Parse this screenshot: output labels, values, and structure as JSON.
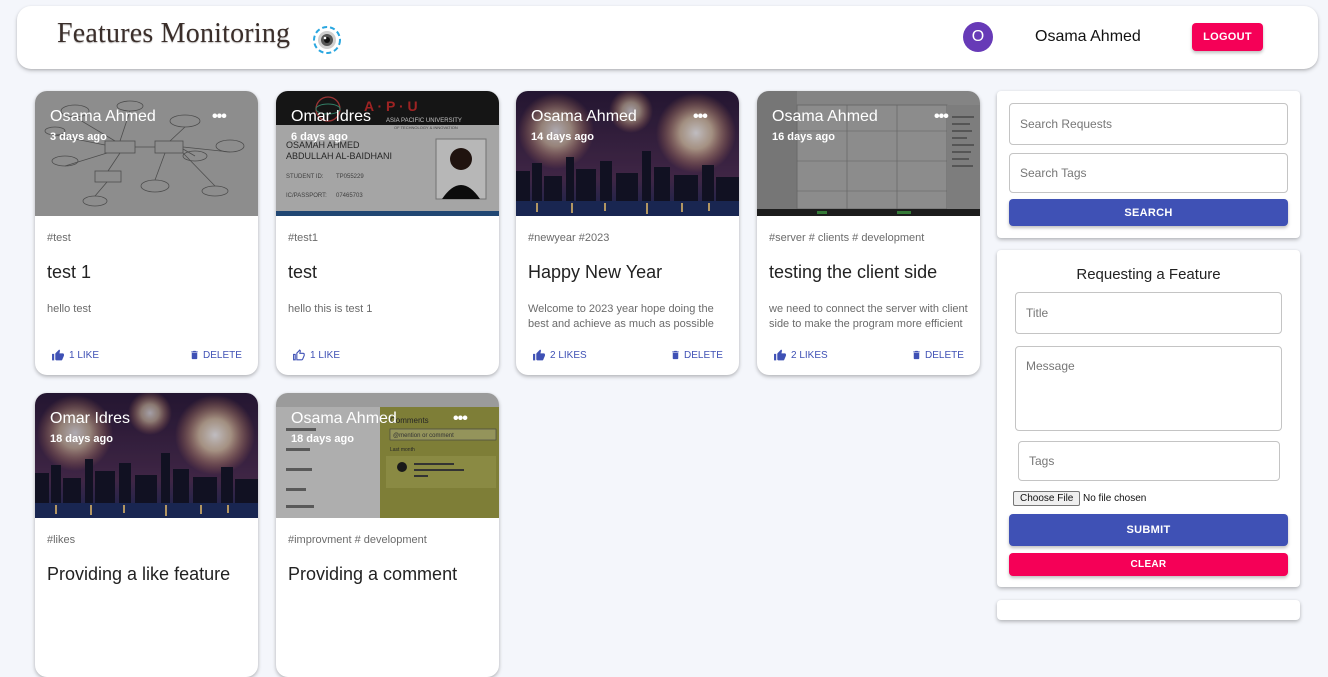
{
  "header": {
    "brand": "Features Monitoring",
    "avatar_letter": "O",
    "username": "Osama Ahmed",
    "logout_label": "LOGOUT"
  },
  "colors": {
    "primary": "#3f51b5",
    "secondary": "#f50057",
    "avatar": "#673ab7",
    "background": "#f4f6fb"
  },
  "posts": [
    {
      "author": "Osama Ahmed",
      "time": "3 days ago",
      "tags": "#test",
      "title": "test 1",
      "message": "hello test",
      "likes": "1 LIKE",
      "delete": "DELETE",
      "image": "er-diagram",
      "has_menu": true
    },
    {
      "author": "Omar Idres",
      "time": "6 days ago",
      "tags": "#test1",
      "title": "test",
      "message": "hello this is test 1",
      "likes": "1 LIKE",
      "delete": "",
      "image": "student-id-card",
      "has_menu": false,
      "image_text": {
        "brand": "A · P · U",
        "uni": "ASIA PACIFIC UNIVERSITY",
        "uni2": "OF TECHNOLOGY & INNOVATION",
        "name1": "OSAMAH AHMED",
        "name2": "ABDULLAH AL-BAIDHANI",
        "label1": "STUDENT ID:",
        "value1": "TP055229",
        "label2": "IC/PASSPORT:",
        "value2": "07465703"
      }
    },
    {
      "author": "Osama Ahmed",
      "time": "14 days ago",
      "tags": "#newyear #2023",
      "title": "Happy New Year",
      "message": "Welcome to 2023 year hope doing the best and achieve as much as possible",
      "likes": "2 LIKES",
      "delete": "DELETE",
      "image": "fireworks",
      "has_menu": true
    },
    {
      "author": "Osama Ahmed",
      "time": "16 days ago",
      "tags": "#server # clients # development",
      "title": "testing the client side",
      "message": "we need to connect the server with client side to make the program more efficient",
      "likes": "2 LIKES",
      "delete": "DELETE",
      "image": "code-editor-screenshot",
      "has_menu": true
    },
    {
      "author": "Omar Idres",
      "time": "18 days ago",
      "tags": "#likes",
      "title": "Providing a like feature",
      "message": "",
      "likes": "",
      "delete": "",
      "image": "fireworks",
      "has_menu": false
    },
    {
      "author": "Osama Ahmed",
      "time": "18 days ago",
      "tags": "#improvment # development",
      "title": "Providing a comment",
      "message": "",
      "likes": "",
      "delete": "",
      "image": "comments-screenshot",
      "has_menu": true,
      "image_text": {
        "comments": "Comments",
        "placeholder": "@mention or comment",
        "last": "Last month"
      }
    }
  ],
  "search": {
    "requests_placeholder": "Search Requests",
    "tags_placeholder": "Search Tags",
    "button": "SEARCH"
  },
  "form": {
    "title": "Requesting a Feature",
    "title_placeholder": "Title",
    "message_placeholder": "Message",
    "tags_placeholder": "Tags",
    "file_button": "Choose File",
    "file_status": "No file chosen",
    "submit": "SUBMIT",
    "clear": "CLEAR"
  }
}
